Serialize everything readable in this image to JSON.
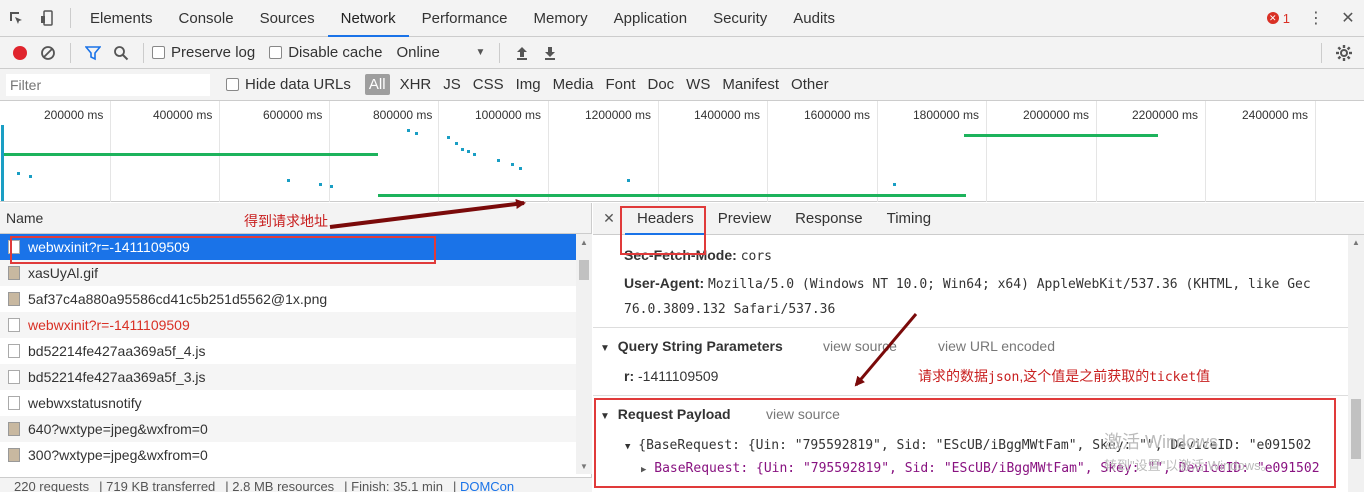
{
  "tabs": [
    "Elements",
    "Console",
    "Sources",
    "Network",
    "Performance",
    "Memory",
    "Application",
    "Security",
    "Audits"
  ],
  "error_count": "1",
  "toolbar": {
    "preserve_log": "Preserve log",
    "disable_cache": "Disable cache",
    "throttle": "Online"
  },
  "filter": {
    "placeholder": "Filter",
    "hide_data_urls": "Hide data URLs",
    "types": [
      "All",
      "XHR",
      "JS",
      "CSS",
      "Img",
      "Media",
      "Font",
      "Doc",
      "WS",
      "Manifest",
      "Other"
    ]
  },
  "timeline": {
    "ticks": [
      "200000 ms",
      "400000 ms",
      "600000 ms",
      "800000 ms",
      "1000000 ms",
      "1200000 ms",
      "1400000 ms",
      "1600000 ms",
      "1800000 ms",
      "2000000 ms",
      "2200000 ms",
      "2400000 ms"
    ]
  },
  "list": {
    "header": "Name",
    "rows": [
      "webwxinit?r=-1411109509",
      "xasUyAl.gif",
      "5af37c4a880a95586cd41c5b251d5562@1x.png",
      "webwxinit?r=-1411109509",
      "bd52214fe427aa369a5f_4.js",
      "bd52214fe427aa369a5f_3.js",
      "webwxstatusnotify",
      "640?wxtype=jpeg&wxfrom=0",
      "300?wxtype=jpeg&wxfrom=0"
    ]
  },
  "status": {
    "requests": "220 requests",
    "transferred": "719 KB transferred",
    "resources": "2.8 MB resources",
    "finish": "Finish: 35.1 min",
    "dom": "DOMCon"
  },
  "detail": {
    "tabs": [
      "Headers",
      "Preview",
      "Response",
      "Timing"
    ],
    "sec_fetch_label": "Sec-Fetch-Mode:",
    "sec_fetch_value": "cors",
    "ua_label": "User-Agent:",
    "ua_value_1": "Mozilla/5.0 (Windows NT 10.0; Win64; x64) AppleWebKit/537.36 (KHTML, like Gec",
    "ua_value_2": "76.0.3809.132 Safari/537.36",
    "qs_title": "Query String Parameters",
    "qs_view_source": "view source",
    "qs_view_url": "view URL encoded",
    "qs_param_label": "r:",
    "qs_param_value": "-1411109509",
    "payload_title": "Request Payload",
    "payload_view_source": "view source",
    "payload_line_1": "{BaseRequest: {Uin: \"795592819\", Sid: \"EScUB/iBggMWtFam\", Skey: \"\", DeviceID: \"e091502",
    "payload_line_2": "BaseRequest: {Uin: \"795592819\", Sid: \"EScUB/iBggMWtFam\", Skey: \"\", DeviceID: \"e091502"
  },
  "annotations": {
    "url_note": "得到请求地址",
    "payload_note_1": "请求的数据",
    "payload_note_json": "json",
    "payload_note_2": ",这个值是之前获取的",
    "payload_note_ticket": "ticket",
    "payload_note_3": "值"
  },
  "watermark": {
    "line1": "激活 Windows",
    "line2": "转到\"设置\"以激活 Windows。"
  },
  "colors": {
    "accent": "#1a73e8",
    "annotation_red": "#e03a3a",
    "arrow": "#7a0a0a",
    "timeline_green": "#1db35c"
  }
}
